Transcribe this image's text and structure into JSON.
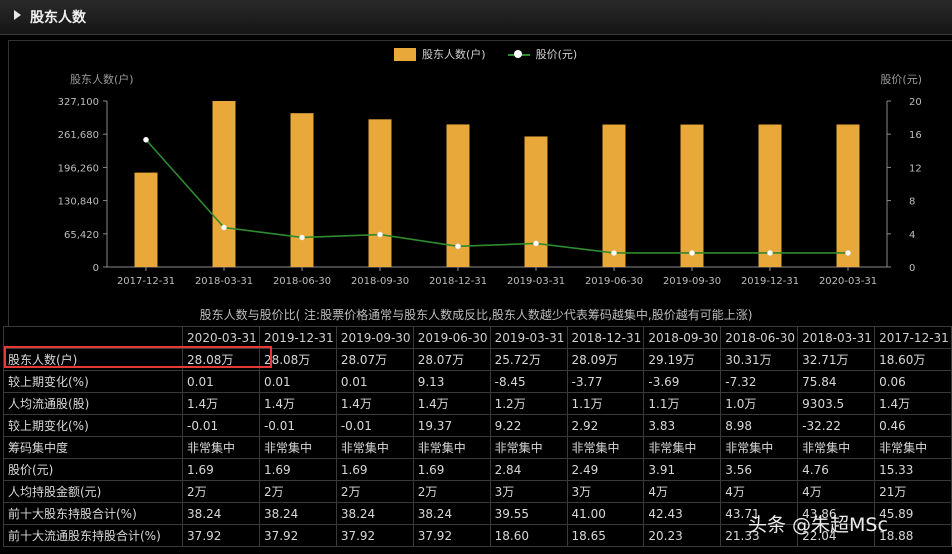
{
  "section": {
    "title": "股东人数",
    "icon": "triangle-right-icon"
  },
  "legend": {
    "bar_label": "股东人数(户)",
    "line_label": "股价(元)"
  },
  "chart_data": {
    "type": "bar+line",
    "categories": [
      "2017-12-31",
      "2018-03-31",
      "2018-06-30",
      "2018-09-30",
      "2018-12-31",
      "2019-03-31",
      "2019-06-30",
      "2019-09-30",
      "2019-12-31",
      "2020-03-31"
    ],
    "series": [
      {
        "name": "股东人数(户)",
        "type": "bar",
        "axis": "left",
        "values": [
          186000,
          327100,
          303100,
          291000,
          280900,
          257200,
          280700,
          280700,
          280800,
          280800
        ]
      },
      {
        "name": "股价(元)",
        "type": "line",
        "axis": "right",
        "values": [
          15.33,
          4.76,
          3.56,
          3.91,
          2.49,
          2.84,
          1.69,
          1.69,
          1.69,
          1.69
        ]
      }
    ],
    "ylabel_left": "股东人数(户)",
    "ylabel_right": "股价(元)",
    "ylim_left": [
      0,
      327100
    ],
    "ylim_right": [
      0,
      20
    ],
    "yticks_left": [
      "0",
      "65,420",
      "130,840",
      "196,260",
      "261,680",
      "327,100"
    ],
    "yticks_right": [
      "0",
      "4",
      "8",
      "12",
      "16",
      "20"
    ],
    "bar_color": "#e8a83a",
    "line_color": "#2e8b2e",
    "marker_color": "#ffffff",
    "grid": false
  },
  "note": "股东人数与股价比( 注:股票价格通常与股东人数成反比,股东人数越少代表筹码越集中,股价越有可能上涨)",
  "table": {
    "columns": [
      "2020-03-31",
      "2019-12-31",
      "2019-09-30",
      "2019-06-30",
      "2019-03-31",
      "2018-12-31",
      "2018-09-30",
      "2018-06-30",
      "2018-03-31",
      "2017-12-31"
    ],
    "rows": [
      {
        "label": "股东人数(户)",
        "values": [
          "28.08万",
          "28.08万",
          "28.07万",
          "28.07万",
          "25.72万",
          "28.09万",
          "29.19万",
          "30.31万",
          "32.71万",
          "18.60万"
        ]
      },
      {
        "label": "较上期变化(%)",
        "values": [
          "0.01",
          "0.01",
          "0.01",
          "9.13",
          "-8.45",
          "-3.77",
          "-3.69",
          "-7.32",
          "75.84",
          "0.06"
        ]
      },
      {
        "label": "人均流通股(股)",
        "values": [
          "1.4万",
          "1.4万",
          "1.4万",
          "1.4万",
          "1.2万",
          "1.1万",
          "1.1万",
          "1.0万",
          "9303.5",
          "1.4万"
        ]
      },
      {
        "label": "较上期变化(%)",
        "values": [
          "-0.01",
          "-0.01",
          "-0.01",
          "19.37",
          "9.22",
          "2.92",
          "3.83",
          "8.98",
          "-32.22",
          "0.46"
        ]
      },
      {
        "label": "筹码集中度",
        "values": [
          "非常集中",
          "非常集中",
          "非常集中",
          "非常集中",
          "非常集中",
          "非常集中",
          "非常集中",
          "非常集中",
          "非常集中",
          "非常集中"
        ]
      },
      {
        "label": "股价(元)",
        "values": [
          "1.69",
          "1.69",
          "1.69",
          "1.69",
          "2.84",
          "2.49",
          "3.91",
          "3.56",
          "4.76",
          "15.33"
        ]
      },
      {
        "label": "人均持股金额(元)",
        "values": [
          "2万",
          "2万",
          "2万",
          "2万",
          "3万",
          "3万",
          "4万",
          "4万",
          "4万",
          "21万"
        ]
      },
      {
        "label": "前十大股东持股合计(%)",
        "values": [
          "38.24",
          "38.24",
          "38.24",
          "38.24",
          "39.55",
          "41.00",
          "42.43",
          "43.71",
          "43.86",
          "45.89"
        ]
      },
      {
        "label": "前十大流通股东持股合计(%)",
        "values": [
          "37.92",
          "37.92",
          "37.92",
          "37.92",
          "18.60",
          "18.65",
          "20.23",
          "21.33",
          "22.04",
          "18.88"
        ]
      }
    ]
  },
  "watermark": "头条 @朱超MSc"
}
